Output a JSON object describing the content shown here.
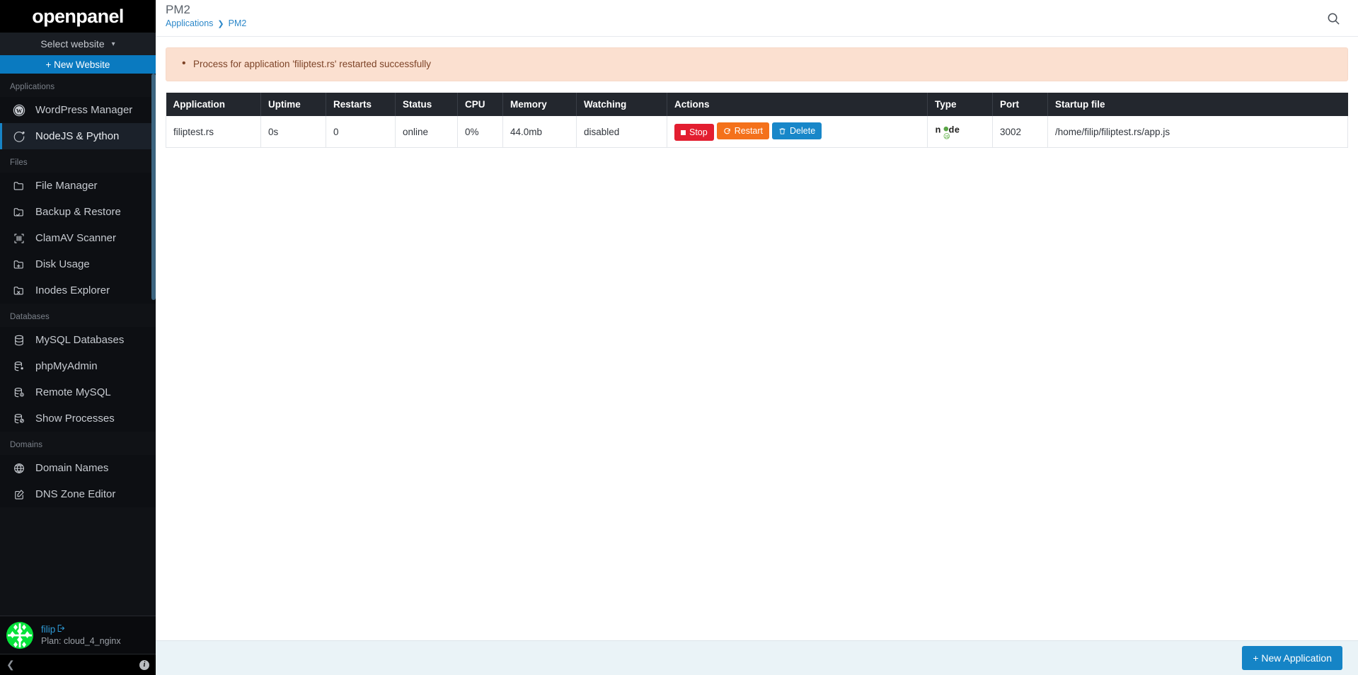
{
  "sidebar": {
    "brand": "openpanel",
    "site_select_label": "Select website",
    "site_select_icon": "chevron-down-icon",
    "new_website_label": "+ New Website",
    "groups": [
      {
        "label": "Applications",
        "items": [
          {
            "label": "WordPress Manager",
            "icon": "wordpress-icon",
            "active": false
          },
          {
            "label": "NodeJS & Python",
            "icon": "nodejs-python-icon",
            "active": true
          }
        ]
      },
      {
        "label": "Files",
        "items": [
          {
            "label": "File Manager",
            "icon": "folder-icon",
            "active": false
          },
          {
            "label": "Backup & Restore",
            "icon": "folder-check-icon",
            "active": false
          },
          {
            "label": "ClamAV Scanner",
            "icon": "scanner-icon",
            "active": false
          },
          {
            "label": "Disk Usage",
            "icon": "folder-plus-icon",
            "active": false
          },
          {
            "label": "Inodes Explorer",
            "icon": "folder-x-icon",
            "active": false
          }
        ]
      },
      {
        "label": "Databases",
        "items": [
          {
            "label": "MySQL Databases",
            "icon": "database-icon",
            "active": false
          },
          {
            "label": "phpMyAdmin",
            "icon": "database-dot-icon",
            "active": false
          },
          {
            "label": "Remote MySQL",
            "icon": "database-info-icon",
            "active": false
          },
          {
            "label": "Show Processes",
            "icon": "database-block-icon",
            "active": false
          }
        ]
      },
      {
        "label": "Domains",
        "items": [
          {
            "label": "Domain Names",
            "icon": "globe-icon",
            "active": false
          },
          {
            "label": "DNS Zone Editor",
            "icon": "edit-square-icon",
            "active": false
          }
        ]
      }
    ],
    "user": {
      "name": "filip",
      "logout_icon": "logout-icon",
      "plan": "Plan: cloud_4_nginx",
      "avatar_icon": "identicon-avatar"
    },
    "footer": {
      "collapse_icon": "chevron-left-icon",
      "info_icon": "info-icon",
      "info_label": "i"
    }
  },
  "header": {
    "title": "PM2",
    "breadcrumb": [
      {
        "label": "Applications",
        "link": true
      },
      {
        "label": "PM2",
        "link": true
      }
    ],
    "breadcrumb_separator": "❯",
    "search_icon": "search-icon"
  },
  "alert": {
    "type": "warning",
    "messages": [
      "Process for application 'filiptest.rs' restarted successfully"
    ],
    "background_color": "#fbe0d0",
    "text_color": "#7d4327"
  },
  "table": {
    "columns": [
      "Application",
      "Uptime",
      "Restarts",
      "Status",
      "CPU",
      "Memory",
      "Watching",
      "Actions",
      "Type",
      "Port",
      "Startup file"
    ],
    "rows": [
      {
        "application": "filiptest.rs",
        "uptime": "0s",
        "restarts": "0",
        "status": "online",
        "status_color": "#21a24a",
        "cpu": "0%",
        "memory": "44.0mb",
        "watching": "disabled",
        "actions": [
          {
            "label": "Stop",
            "icon": "stop-square-icon",
            "color": "#e31e30"
          },
          {
            "label": "Restart",
            "icon": "refresh-icon",
            "color": "#f4711b"
          },
          {
            "label": "Delete",
            "icon": "trash-icon",
            "color": "#1887c9"
          }
        ],
        "type_icon": "nodejs-logo",
        "port": "3002",
        "startup_file": "/home/filip/filiptest.rs/app.js"
      }
    ]
  },
  "footer": {
    "new_application_label": "+ New Application"
  }
}
